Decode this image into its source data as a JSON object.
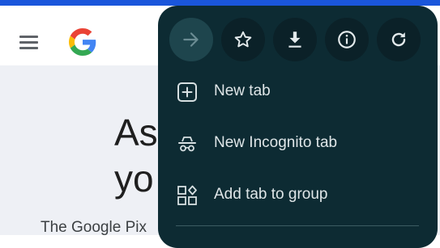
{
  "background": {
    "heading_line1": "As",
    "heading_line2": "yo",
    "body_text": "The Google Pix"
  },
  "menu": {
    "icon_buttons": [
      {
        "icon": "arrow-forward-icon",
        "enabled": false
      },
      {
        "icon": "star-icon",
        "enabled": true
      },
      {
        "icon": "download-icon",
        "enabled": true
      },
      {
        "icon": "info-icon",
        "enabled": true
      },
      {
        "icon": "refresh-icon",
        "enabled": true
      }
    ],
    "items": [
      {
        "label": "New tab",
        "icon": "new-tab-icon"
      },
      {
        "label": "New Incognito tab",
        "icon": "incognito-icon"
      },
      {
        "label": "Add tab to group",
        "icon": "tab-group-icon"
      }
    ]
  },
  "colors": {
    "menu_background": "#0d2b33",
    "icon_button_background": "#0b2128",
    "icon_color": "#e3eaec",
    "top_strip": "#1a56db"
  }
}
